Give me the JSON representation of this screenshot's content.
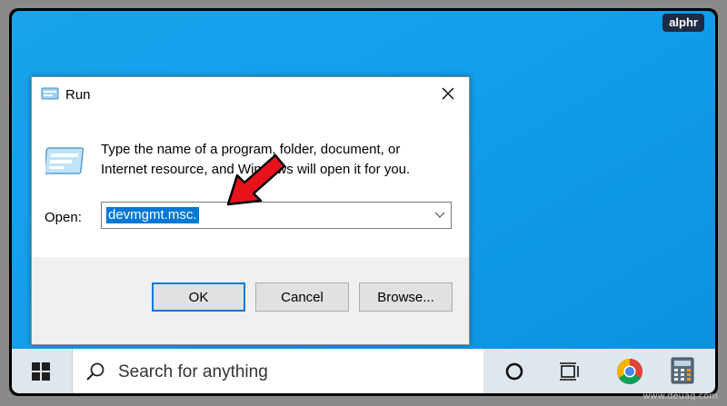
{
  "brand": "alphr",
  "watermark": "www.deuaq.com",
  "dialog": {
    "title": "Run",
    "description_line1": "Type the name of a program, folder, document, or",
    "description_line2": "Internet resource, and Windows will open it for you.",
    "open_label": "Open:",
    "open_value": "devmgmt.msc.",
    "buttons": {
      "ok": "OK",
      "cancel": "Cancel",
      "browse": "Browse..."
    }
  },
  "taskbar": {
    "search_placeholder": "Search for anything",
    "icons": [
      "windows-start-icon",
      "cortana-icon",
      "task-view-icon",
      "chrome-icon",
      "calculator-icon"
    ]
  },
  "colors": {
    "desktop": "#12a0ec",
    "accent": "#0078d7",
    "annotation_arrow": "#e8121b"
  }
}
